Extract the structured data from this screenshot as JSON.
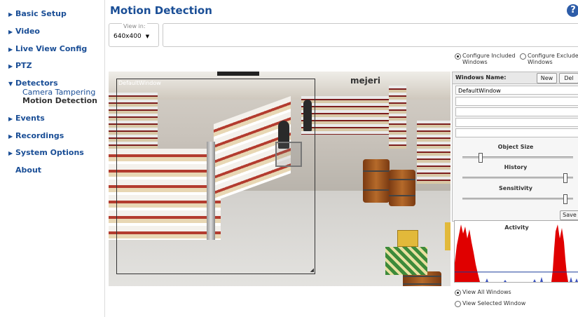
{
  "sidebar": {
    "items": [
      {
        "label": "Basic Setup"
      },
      {
        "label": "Video"
      },
      {
        "label": "Live View Config"
      },
      {
        "label": "PTZ"
      },
      {
        "label": "Detectors",
        "subitems": [
          "Camera Tampering",
          "Motion Detection"
        ]
      },
      {
        "label": "Events"
      },
      {
        "label": "Recordings"
      },
      {
        "label": "System Options"
      },
      {
        "label": "About"
      }
    ]
  },
  "header": {
    "title": "Motion Detection",
    "help_icon": "help-icon"
  },
  "view_in": {
    "legend": "View in:",
    "selected": "640x400"
  },
  "config_mode": {
    "included_label": "Configure Included Windows",
    "excluded_label": "Configure Excluded Windows",
    "selected": "included"
  },
  "video": {
    "window_label": "DefaultWindow",
    "store_sign": "mejeri"
  },
  "windows_panel": {
    "title": "Windows Name:",
    "new_label": "New",
    "del_label": "Del",
    "windows": [
      "DefaultWindow",
      "",
      "",
      "",
      ""
    ],
    "save_label": "Save",
    "sliders": [
      {
        "label": "Object Size",
        "value": 0.15
      },
      {
        "label": "History",
        "value": 0.95
      },
      {
        "label": "Sensitivity",
        "value": 0.95
      }
    ]
  },
  "activity": {
    "title": "Activity",
    "level": 0.45
  },
  "view_mode": {
    "all_label": "View All Windows",
    "selected_label": "View Selected Window",
    "selected": "all"
  },
  "colors": {
    "link": "#1a4e96",
    "activity": "#e00000",
    "level_line": "#1a3c9a"
  }
}
